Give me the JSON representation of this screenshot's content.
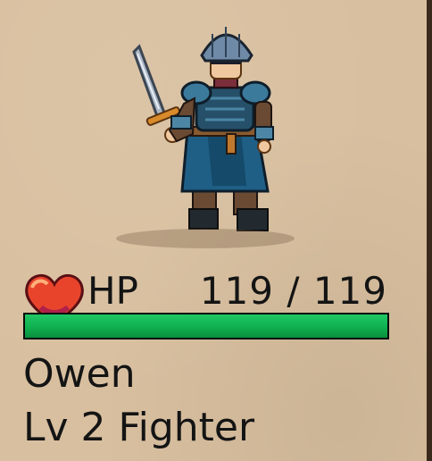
{
  "character": {
    "name": "Owen",
    "level_class": "Lv 2 Fighter"
  },
  "hp": {
    "label": "HP",
    "display": "119 / 119",
    "current": 119,
    "max": 119,
    "fill_fraction": 1.0
  },
  "icons": {
    "heart": "heart-icon",
    "sprite": "knight-sprite"
  },
  "colors": {
    "panel_bg": "#d8bf9f",
    "hp_bar_fill": "#0fb04f",
    "text": "#141414"
  }
}
